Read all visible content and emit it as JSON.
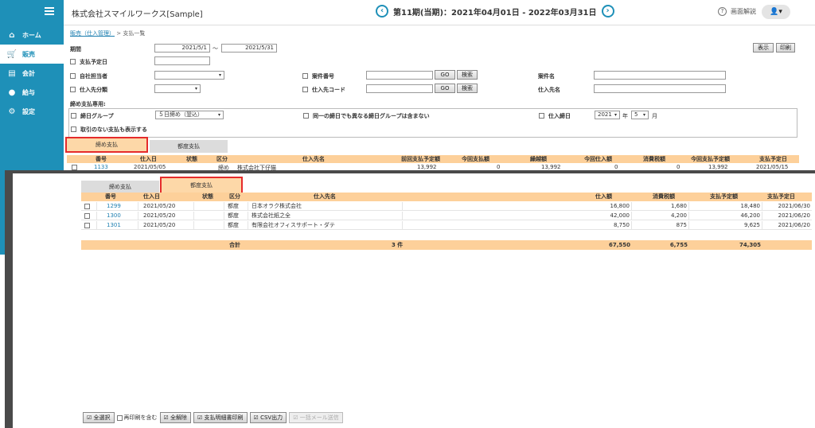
{
  "sidebar": {
    "items": [
      {
        "label": "ホーム",
        "icon": "home-icon",
        "glyph": "⌂"
      },
      {
        "label": "販売",
        "icon": "cart-icon",
        "glyph": "🛒"
      },
      {
        "label": "会計",
        "icon": "calculator-icon",
        "glyph": "▤"
      },
      {
        "label": "給与",
        "icon": "money-bag-icon",
        "glyph": "●"
      },
      {
        "label": "設定",
        "icon": "gear-icon",
        "glyph": "⚙"
      }
    ],
    "active_index": 1,
    "color": "#1e90b8"
  },
  "header": {
    "company": "株式会社スマイルワークス[Sample]",
    "period": "第11期(当期)：2021年04月01日 - 2022年03月31日",
    "prev_glyph": "‹",
    "next_glyph": "›",
    "help_label": "画面解説",
    "help_glyph": "?",
    "user_glyph": "👤▾"
  },
  "breadcrumb": {
    "link": "販売（仕入管理）",
    "sep": " > ",
    "current": "支払一覧"
  },
  "filters": {
    "period_label": "期間",
    "period_from": "2021/5/1",
    "period_tilde": "～",
    "period_to": "2021/5/31",
    "pay_date_label": "支払予定日",
    "staff_label": "自社担当者",
    "supplier_cat_label": "仕入先分類",
    "project_no_label": "案件番号",
    "supplier_code_label": "仕入先コード",
    "project_name_label": "案件名",
    "supplier_name_label": "仕入先名",
    "go_label": "GO",
    "search_label": "検索",
    "show_label": "表示",
    "print_label": "印刷",
    "closing_section_label": "締め支払専用:",
    "closing_group_label": "締日グループ",
    "closing_group_value": "５日締め（翌込）",
    "same_group_label": "同一の締日でも異なる締日グループは含まない",
    "purchase_close_label": "仕入締日",
    "year_value": "2021",
    "year_unit": "年",
    "month_value": "5",
    "month_unit": "月",
    "no_trade_label": "取引のない支払も表示する"
  },
  "back_tabs": [
    {
      "label": "締め支払"
    },
    {
      "label": "都度支払"
    }
  ],
  "back_table": {
    "headers": [
      "番号",
      "仕入日",
      "状態",
      "区分",
      "仕入先名",
      "前回支払予定額",
      "今回支払額",
      "繰越額",
      "今回仕入額",
      "消費税額",
      "今回支払予定額",
      "支払予定日"
    ],
    "row": {
      "no": "1133",
      "date": "2021/05/05",
      "status": "",
      "kind": "締め",
      "name": "株式会社下仔猫",
      "prev": "13,992",
      "paid": "0",
      "carry": "13,992",
      "purchase": "0",
      "tax": "0",
      "due_amount": "13,992",
      "due_date": "2021/05/15"
    }
  },
  "front_tabs": [
    {
      "label": "締め支払"
    },
    {
      "label": "都度支払"
    }
  ],
  "front_table": {
    "headers": [
      "番号",
      "仕入日",
      "状態",
      "区分",
      "仕入先名",
      "仕入額",
      "消費税額",
      "支払予定額",
      "支払予定日"
    ],
    "rows": [
      {
        "no": "1299",
        "date": "2021/05/20",
        "status": "",
        "kind": "都度",
        "name": "日本オラク株式会社",
        "amount": "16,800",
        "tax": "1,680",
        "due_amount": "18,480",
        "due_date": "2021/06/30"
      },
      {
        "no": "1300",
        "date": "2021/05/20",
        "status": "",
        "kind": "都度",
        "name": "株式会社紙之全",
        "amount": "42,000",
        "tax": "4,200",
        "due_amount": "46,200",
        "due_date": "2021/06/20"
      },
      {
        "no": "1301",
        "date": "2021/05/20",
        "status": "",
        "kind": "都度",
        "name": "有限会社オフィスサポート・ダテ",
        "amount": "8,750",
        "tax": "875",
        "due_amount": "9,625",
        "due_date": "2021/06/20"
      }
    ],
    "footer": {
      "label": "合計",
      "count": "3 件",
      "amount": "67,550",
      "tax": "6,755",
      "due_amount": "74,305"
    }
  },
  "bottom_bar": {
    "select_all": "全選択",
    "reprint": "再印刷を含む",
    "clear_all": "全解除",
    "print_detail": "支払明細書印刷",
    "csv": "CSV出力",
    "mail": "一括メール送信"
  },
  "colors": {
    "accent": "#1e90b8",
    "header_row": "#fdd09a",
    "tab_active": "#fdd8a8",
    "highlight": "#e52b2b"
  }
}
